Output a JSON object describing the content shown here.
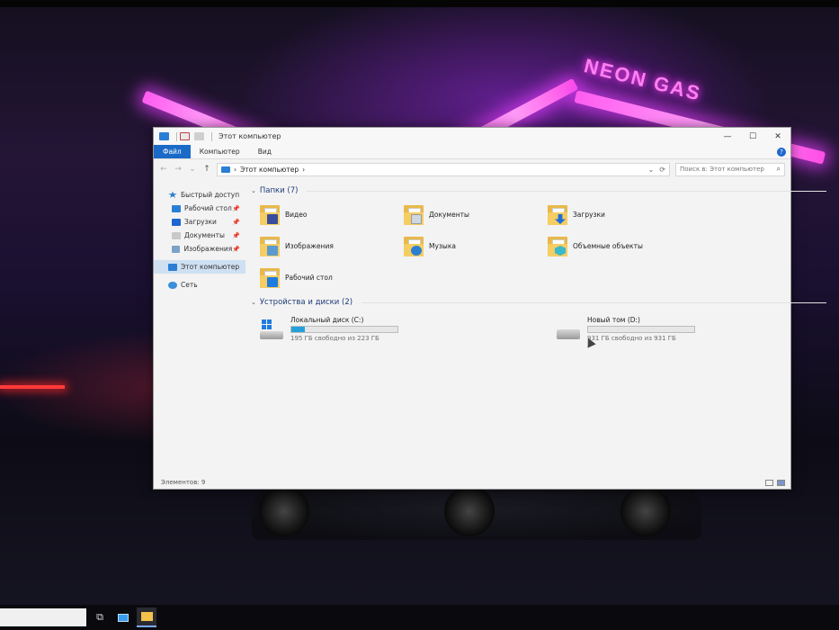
{
  "wallpaper": {
    "sign_text": "NEON GAS"
  },
  "window": {
    "title": "Этот компьютер",
    "controls": {
      "minimize": "—",
      "maximize": "☐",
      "close": "✕"
    }
  },
  "ribbon": {
    "tabs": [
      "Файл",
      "Компьютер",
      "Вид"
    ],
    "help": "?"
  },
  "address": {
    "back": "←",
    "forward": "→",
    "recent": "⌄",
    "up": "↑",
    "path": "Этот компьютер",
    "path_sep": "›",
    "dropdown": "⌄",
    "refresh": "⟳",
    "search_placeholder": "Поиск в: Этот компьютер",
    "search_glyph": "⌕"
  },
  "nav": {
    "quick_access": "Быстрый доступ",
    "pinned": [
      {
        "label": "Рабочий стол",
        "pin": "📌",
        "color": "#2a7fd4"
      },
      {
        "label": "Загрузки",
        "pin": "📌",
        "color": "#1e66d0"
      },
      {
        "label": "Документы",
        "pin": "📌",
        "color": "#c9c9c9"
      },
      {
        "label": "Изображения",
        "pin": "📌",
        "color": "#7aa3c8"
      }
    ],
    "this_pc": "Этот компьютер",
    "network": "Сеть"
  },
  "folders": {
    "header": "Папки (7)",
    "chevron": "⌄",
    "items": [
      {
        "label": "Видео",
        "overlay": "#3a4d9c",
        "icon": "video-folder-icon"
      },
      {
        "label": "Документы",
        "overlay": "#cfd7e3",
        "icon": "documents-folder-icon"
      },
      {
        "label": "Загрузки",
        "overlay": "#1f6ed6",
        "icon": "downloads-folder-icon"
      },
      {
        "label": "Изображения",
        "overlay": "#5a9ad0",
        "icon": "pictures-folder-icon"
      },
      {
        "label": "Музыка",
        "overlay": "#2b7fd0",
        "icon": "music-folder-icon"
      },
      {
        "label": "Объемные объекты",
        "overlay": "#39b9c9",
        "icon": "3d-objects-folder-icon"
      },
      {
        "label": "Рабочий стол",
        "overlay": "#1e7ce0",
        "icon": "desktop-folder-icon"
      }
    ]
  },
  "drives": {
    "header": "Устройства и диски (2)",
    "chevron": "⌄",
    "items": [
      {
        "name": "Локальный диск (C:)",
        "free": "195 ГБ свободно из 223 ГБ",
        "used_fraction": 0.126,
        "icon": "system-drive-icon"
      },
      {
        "name": "Новый том (D:)",
        "free": "931 ГБ свободно из 931 ГБ",
        "used_fraction": 0.0,
        "icon": "hard-drive-icon"
      }
    ]
  },
  "status": {
    "items": "Элементов: 9"
  },
  "taskbar": {
    "task_view_glyph": "⧉"
  }
}
